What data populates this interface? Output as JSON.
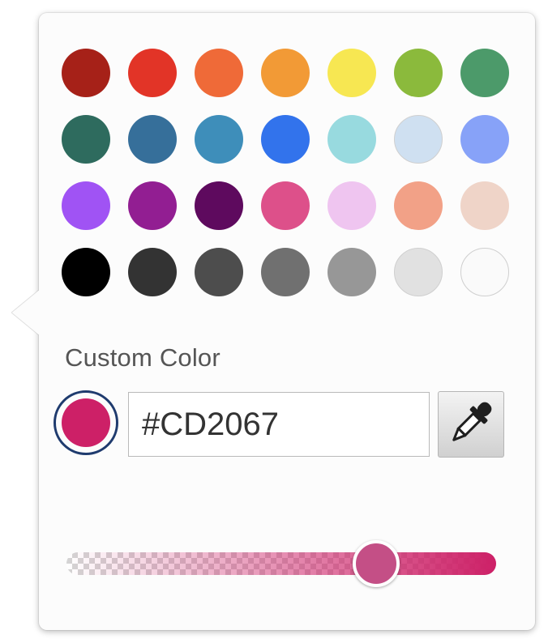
{
  "palette": {
    "rows": [
      [
        "#A62118",
        "#E23427",
        "#EF6A38",
        "#F29A36",
        "#F7E752",
        "#8BBA3C",
        "#4C9A6A"
      ],
      [
        "#2E6B5E",
        "#366F9A",
        "#3E8EBA",
        "#3273EC",
        "#98DADF",
        "#CFE0F1",
        "#87A2F8"
      ],
      [
        "#A053F4",
        "#921E92",
        "#5E0A5E",
        "#DD508A",
        "#EFC5F0",
        "#F2A187",
        "#EFD4C8"
      ],
      [
        "#000000",
        "#333333",
        "#4D4D4D",
        "#707070",
        "#979797",
        "#E1E1E1",
        "#FAFAFA"
      ]
    ]
  },
  "custom": {
    "label": "Custom Color",
    "hex_value": "#CD2067",
    "current_color": "#CD2067",
    "ring_color": "#1F3B6E"
  },
  "icons": {
    "eyedropper": "eyedropper-icon"
  },
  "opacity": {
    "value": 0.72,
    "thumb_color": "#C44F86"
  }
}
